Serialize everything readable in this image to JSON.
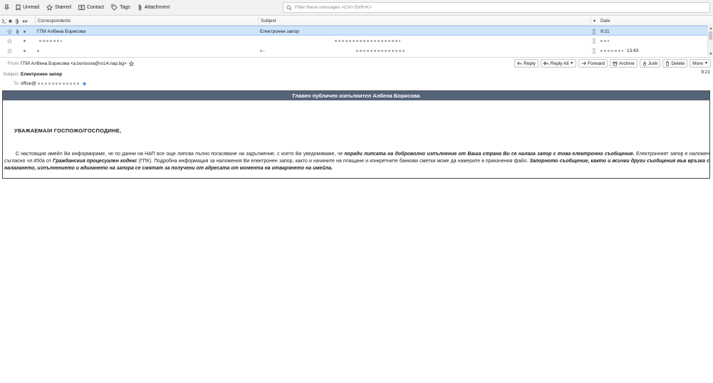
{
  "quick_filter": {
    "unread_label": "Unread",
    "starred_label": "Starred",
    "contact_label": "Contact",
    "tags_label": "Tags",
    "attachment_label": "Attachment",
    "filter_placeholder": "Filter these messages <Ctrl+Shift+K>"
  },
  "thread_list": {
    "columns": {
      "correspondents": "Correspondents",
      "subject": "Subject",
      "date": "Date"
    },
    "rows": [
      {
        "correspondent": "ГПИ Албена Борисова",
        "subject": "Електронен запор",
        "date": "9:21",
        "selected": true
      },
      {
        "correspondent": "",
        "subject": "",
        "date": "",
        "selected": false
      },
      {
        "correspondent": "",
        "subject": "",
        "date": "13:43",
        "selected": false
      }
    ]
  },
  "message": {
    "from_label": "From",
    "from_value": "ГПИ Албена Борисова <a.borisova@ro14.nap.bg>",
    "subject_label": "Subject",
    "subject_value": "Електронен запор",
    "to_label": "To",
    "to_value": "office@",
    "time": "9:21",
    "actions": {
      "reply": "Reply",
      "reply_all": "Reply All",
      "forward": "Forward",
      "archive": "Archive",
      "junk": "Junk",
      "delete": "Delete",
      "more": "More"
    }
  },
  "body": {
    "banner": "Главен публичен изпълнител Албена Борисова",
    "greeting": "УВАЖАЕМА/И ГОСПОЖО/ГОСПОДИНЕ,",
    "p1": "С настоящия имейл Ви информираме, че по данни на НАП все още липсва пълно погасяване на задължение, с което Ви уведомяваме, че ",
    "p1_bold": "поради липсата на доброволно изпълнение от Ваша страна Ви се налага запор с това електронно съобщение.",
    "p2": " Електронният запор е наложен съгласно чл.450а от ",
    "p2_bold": "Гражданския процесуален кодекс",
    "p3": " (ГПК). Подробна информация за наложения Ви електронен запор, както и начините на плащане и конкретните банкови сметки може да намерите в прикачения файл. ",
    "p3_bold": "Запорното съобщение, както и всички други съобщения във връзка с налагането, изпълнението и вдигането на запора се смятат за получени от адресата от момента на отварянето на имейла."
  },
  "colors": {
    "selection": "#cfe5fb",
    "banner": "#56647a",
    "star": "#3c7fd8"
  }
}
